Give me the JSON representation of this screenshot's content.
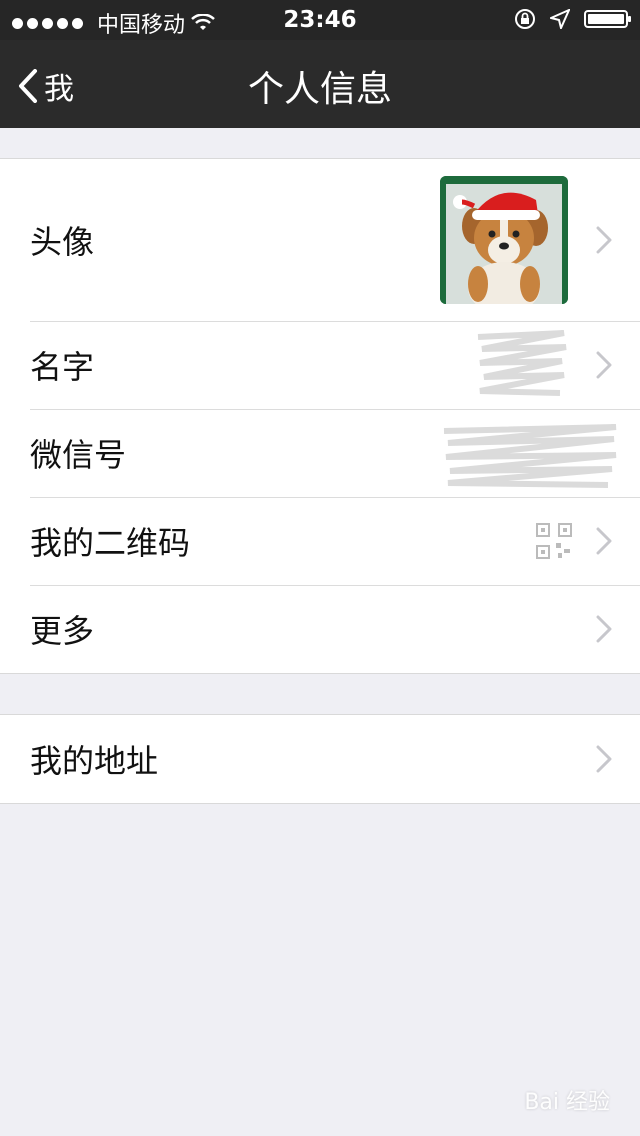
{
  "status_bar": {
    "carrier": "中国移动",
    "time": "23:46"
  },
  "nav": {
    "back_label": "我",
    "title": "个人信息"
  },
  "groups": [
    {
      "rows": [
        {
          "label": "头像"
        },
        {
          "label": "名字"
        },
        {
          "label": "微信号"
        },
        {
          "label": "我的二维码"
        },
        {
          "label": "更多"
        }
      ]
    },
    {
      "rows": [
        {
          "label": "我的地址"
        }
      ]
    }
  ],
  "watermark": "Bai 经验",
  "colors": {
    "nav_background": "#2b2b2b",
    "page_background": "#efeff4",
    "chevron": "#c7c7cc"
  },
  "icons": [
    "wifi-icon",
    "lock-rotation-icon",
    "location-arrow-icon",
    "battery-icon",
    "back-chevron-icon",
    "chevron-right-icon",
    "qr-code-icon"
  ]
}
